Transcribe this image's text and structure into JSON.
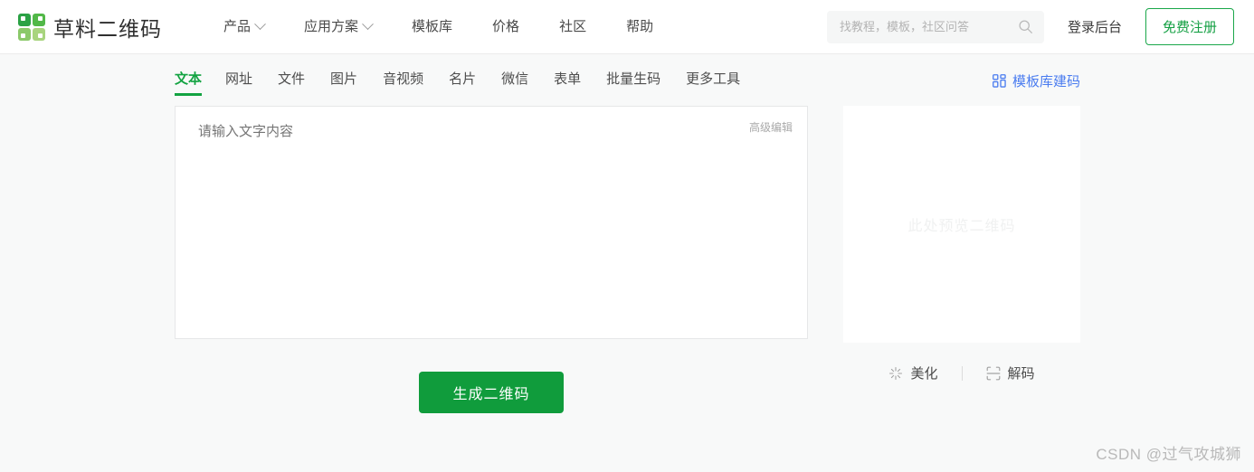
{
  "header": {
    "brand_name": "草料二维码",
    "logo_icon": "qrcode-logo-icon",
    "nav": [
      {
        "label": "产品",
        "has_dropdown": true
      },
      {
        "label": "应用方案",
        "has_dropdown": true
      },
      {
        "label": "模板库",
        "has_dropdown": false
      },
      {
        "label": "价格",
        "has_dropdown": false
      },
      {
        "label": "社区",
        "has_dropdown": false
      },
      {
        "label": "帮助",
        "has_dropdown": false
      }
    ],
    "search": {
      "placeholder": "找教程，模板，社区问答",
      "value": "",
      "icon": "search-icon"
    },
    "login_label": "登录后台",
    "register_label": "免费注册"
  },
  "tabs": [
    {
      "label": "文本",
      "active": true
    },
    {
      "label": "网址",
      "active": false
    },
    {
      "label": "文件",
      "active": false
    },
    {
      "label": "图片",
      "active": false
    },
    {
      "label": "音视频",
      "active": false
    },
    {
      "label": "名片",
      "active": false
    },
    {
      "label": "微信",
      "active": false
    },
    {
      "label": "表单",
      "active": false
    },
    {
      "label": "批量生码",
      "active": false
    },
    {
      "label": "更多工具",
      "active": false
    }
  ],
  "editor": {
    "placeholder": "请输入文字内容",
    "value": "",
    "advanced_edit_label": "高级编辑"
  },
  "generate_button_label": "生成二维码",
  "preview": {
    "template_link_label": "模板库建码",
    "template_link_icon": "qrcode-grid-icon",
    "placeholder_text": "此处预览二维码",
    "actions": [
      {
        "label": "美化",
        "icon": "sparkle-icon"
      },
      {
        "label": "解码",
        "icon": "scan-frame-icon"
      }
    ]
  },
  "watermark": "CSDN @过气攻城狮",
  "colors": {
    "brand_green": "#13a342",
    "button_green": "#109c3c",
    "link_blue": "#4a7cf0",
    "page_bg": "#f8f9f9",
    "header_bg": "#ffffff"
  }
}
